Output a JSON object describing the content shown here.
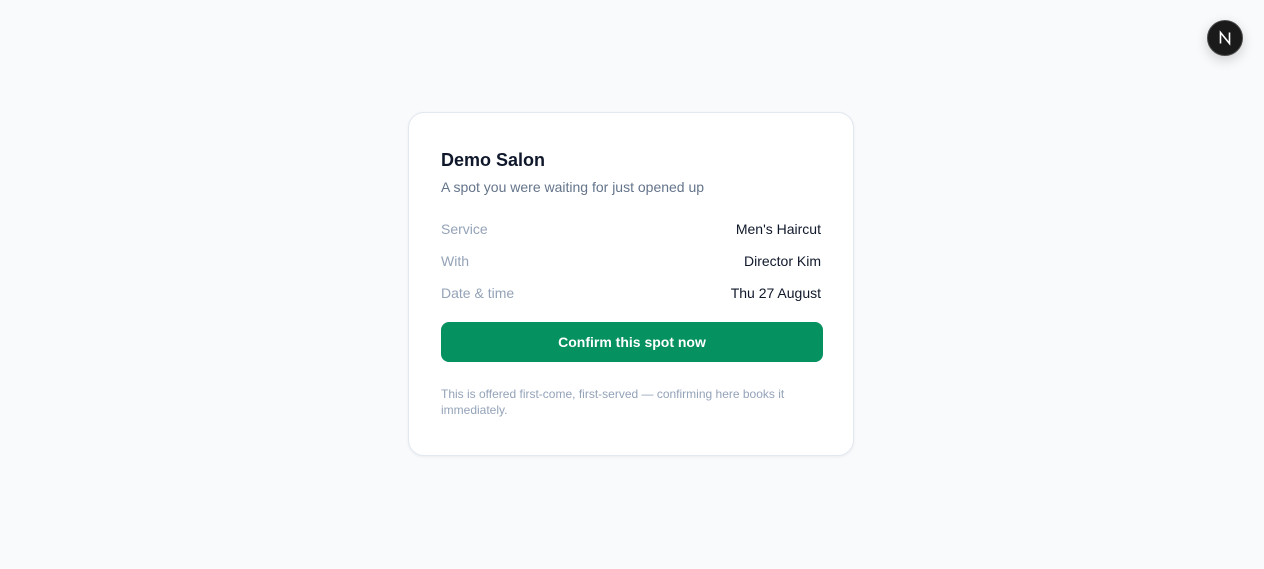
{
  "card": {
    "title": "Demo Salon",
    "subtitle": "A spot you were waiting for just opened up",
    "details": [
      {
        "label": "Service",
        "value": "Men's Haircut"
      },
      {
        "label": "With",
        "value": "Director Kim"
      },
      {
        "label": "Date & time",
        "value": "Thu 27 August"
      }
    ],
    "confirm_label": "Confirm this spot now",
    "note": "This is offered first-come, first-served — confirming here books it immediately."
  },
  "floating_button": {
    "icon": "next-logo-icon",
    "letter": "N"
  },
  "colors": {
    "background": "#f8fafc",
    "accent": "#059160",
    "title": "#0f172a",
    "muted": "#94a3b8"
  }
}
